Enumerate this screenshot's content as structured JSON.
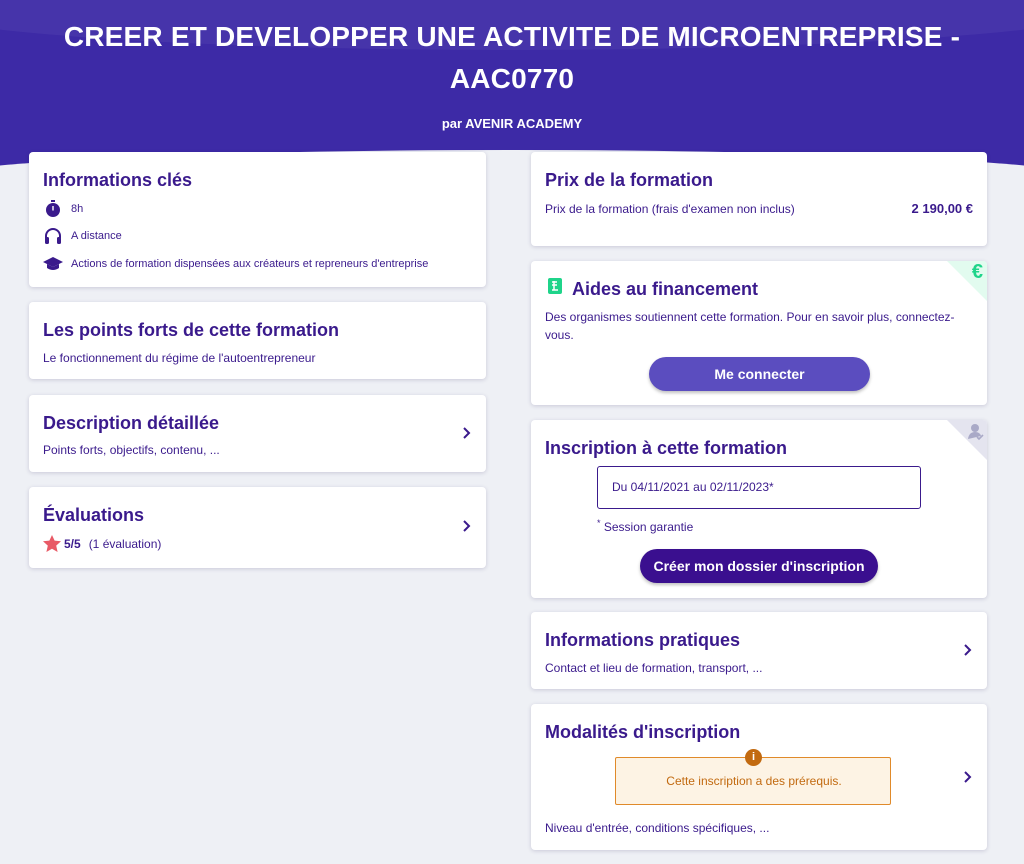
{
  "header": {
    "title": "CREER ET DEVELOPPER UNE ACTIVITE DE MICROENTREPRISE - AAC0770",
    "subtitle": "par AVENIR ACADEMY"
  },
  "key_info": {
    "title": "Informations clés",
    "duration": "8h",
    "mode": "A distance",
    "category": "Actions de formation dispensées aux créateurs et repreneurs d'entreprise"
  },
  "strengths": {
    "title": "Les points forts de cette formation",
    "text": "Le fonctionnement du régime de l'autoentrepreneur"
  },
  "description": {
    "title": "Description détaillée",
    "text": "Points forts, objectifs, contenu, ..."
  },
  "evaluations": {
    "title": "Évaluations",
    "score": "5/5",
    "count": "(1 évaluation)",
    "rating": 5,
    "max": 5
  },
  "price": {
    "title": "Prix de la formation",
    "label": "Prix de la formation (frais d'examen non inclus)",
    "amount": "2 190,00 €"
  },
  "funding": {
    "title": "Aides au financement",
    "text": "Des organismes soutiennent cette formation. Pour en savoir plus, connectez-vous.",
    "button": "Me connecter",
    "corner_symbol": "€"
  },
  "registration": {
    "title": "Inscription à cette formation",
    "session": "Du 04/11/2021 au 02/11/2023*",
    "note_star": "*",
    "note": "Session garantie",
    "button": "Créer mon dossier d'inscription"
  },
  "practical": {
    "title": "Informations pratiques",
    "text": "Contact et lieu de formation, transport, ..."
  },
  "modalities": {
    "title": "Modalités d'inscription",
    "info_symbol": "i",
    "alert": "Cette inscription a des prérequis.",
    "text": "Niveau d'entrée, conditions spécifiques, ..."
  },
  "colors": {
    "brand": "#3d2aa6",
    "text": "#3a1a8c",
    "button_light": "#5b4dbf",
    "button_dark": "#3a0f8f",
    "star": "#e85a66",
    "euro": "#1fd48a",
    "warning": "#c26a10"
  }
}
